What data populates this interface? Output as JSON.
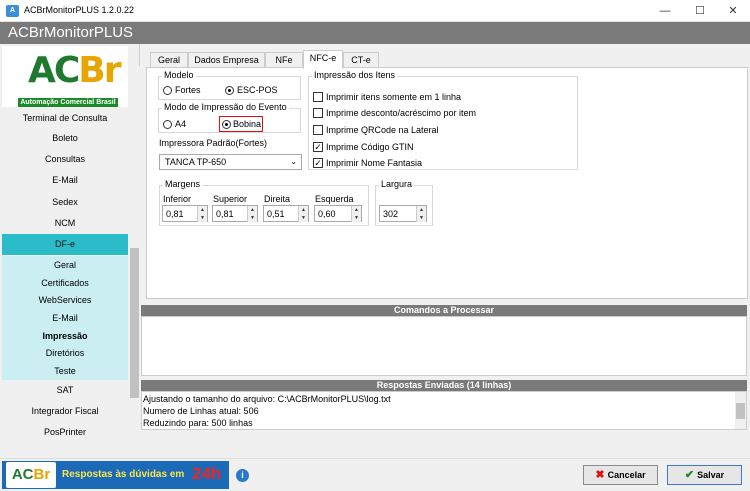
{
  "window": {
    "title": "ACBrMonitorPLUS 1.2.0.22",
    "minimize_glyph": "—",
    "maximize_glyph": "☐",
    "close_glyph": "✕"
  },
  "header": {
    "title": "ACBrMonitorPLUS"
  },
  "logo": {
    "text_a": "AC",
    "text_b": "Br",
    "tagline": "Automação Comercial Brasil"
  },
  "sidebar": {
    "items": [
      "Terminal de Consulta",
      "Boleto",
      "Consultas",
      "E-Mail",
      "Sedex",
      "NCM"
    ],
    "dfe": "DF-e",
    "dfe_sub": [
      "Geral",
      "Certificados",
      "WebServices",
      "E-Mail",
      "Impressão",
      "Diretórios",
      "Teste"
    ],
    "after": [
      "SAT",
      "Integrador Fiscal",
      "PosPrinter"
    ]
  },
  "tabs": [
    "Geral",
    "Dados Empresa",
    "NFe",
    "NFC-e",
    "CT-e"
  ],
  "active_tab": "NFC-e",
  "form": {
    "modelo": {
      "title": "Modelo",
      "options": [
        "Fortes",
        "ESC-POS"
      ],
      "selected": "ESC-POS"
    },
    "modo": {
      "title": "Modo de Impressão do Evento",
      "options": [
        "A4",
        "Bobina"
      ],
      "selected": "Bobina"
    },
    "impressora": {
      "label": "Impressora Padrão(Fortes)",
      "value": "TANCA TP-650"
    },
    "margens": {
      "title": "Margens",
      "fields": [
        {
          "label": "Inferior",
          "value": "0,81"
        },
        {
          "label": "Superior",
          "value": "0,81"
        },
        {
          "label": "Direita",
          "value": "0,51"
        },
        {
          "label": "Esquerda",
          "value": "0,60"
        }
      ]
    },
    "largura": {
      "title": "Largura",
      "value": "302"
    },
    "impressao_itens": {
      "title": "Impressão dos Itens",
      "checks": [
        {
          "label": "Imprimir itens somente em 1 linha",
          "checked": false
        },
        {
          "label": "Imprime desconto/acréscimo por item",
          "checked": false
        },
        {
          "label": "Imprime QRCode na Lateral",
          "checked": false
        },
        {
          "label": "Imprime Código GTIN",
          "checked": true
        },
        {
          "label": "Imprimir Nome Fantasia",
          "checked": true
        }
      ]
    }
  },
  "comandos": {
    "title": "Comandos a Processar"
  },
  "respostas": {
    "title": "Respostas Enviadas (14 linhas)",
    "lines": [
      "Ajustando o tamanho do arquivo: C:\\ACBrMonitorPLUS\\log.txt",
      "Numero de Linhas atual: 506",
      "Reduzindo para: 500 linhas"
    ]
  },
  "footer": {
    "banner_text": "Respostas às dúvidas em",
    "banner_24h": "24h",
    "info": "i",
    "cancel": "Cancelar",
    "save": "Salvar"
  },
  "colors": {
    "dfe": "#2bbcca",
    "dfe_sub": "#cbeef3",
    "header": "#7a7a7a",
    "selection_box": "#d11"
  }
}
